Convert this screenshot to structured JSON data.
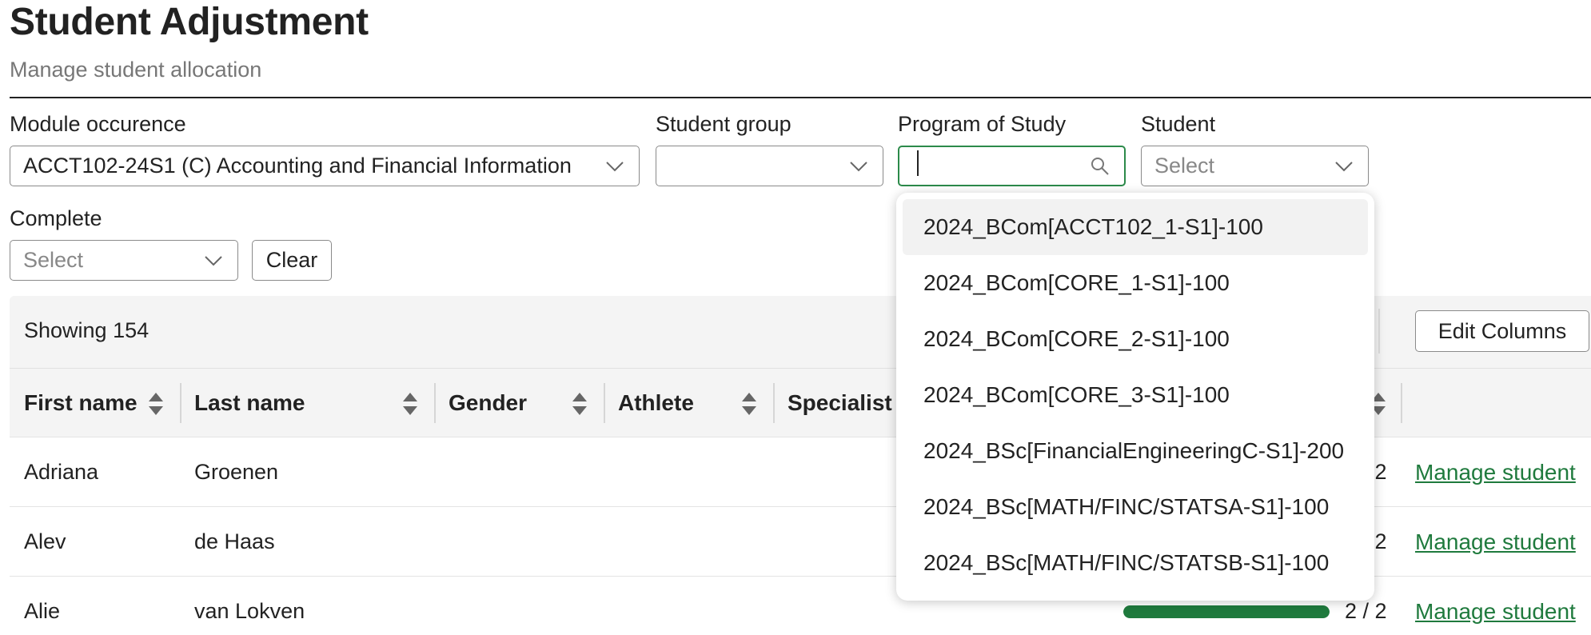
{
  "header": {
    "title": "Student Adjustment",
    "subtitle": "Manage student allocation"
  },
  "filters": {
    "module": {
      "label": "Module occurence",
      "value": "ACCT102-24S1 (C) Accounting and Financial Information"
    },
    "student_group": {
      "label": "Student group",
      "value": ""
    },
    "program": {
      "label": "Program of Study",
      "value": ""
    },
    "student": {
      "label": "Student",
      "placeholder": "Select"
    },
    "complete": {
      "label": "Complete",
      "placeholder": "Select"
    },
    "clear_label": "Clear"
  },
  "program_options": [
    "2024_BCom[ACCT102_1-S1]-100",
    "2024_BCom[CORE_1-S1]-100",
    "2024_BCom[CORE_2-S1]-100",
    "2024_BCom[CORE_3-S1]-100",
    "2024_BSc[FinancialEngineeringC-S1]-200",
    "2024_BSc[MATH/FINC/STATSA-S1]-100",
    "2024_BSc[MATH/FINC/STATSB-S1]-100"
  ],
  "table": {
    "showing": "Showing 154",
    "edit_columns_label": "Edit Columns",
    "columns": [
      "First name",
      "Last name",
      "Gender",
      "Athlete",
      "Specialist"
    ],
    "rows": [
      {
        "first": "Adriana",
        "last": "Groenen",
        "progress_text": "2 / 2",
        "progress": 1.0,
        "action": "Manage student"
      },
      {
        "first": "Alev",
        "last": "de Haas",
        "progress_text": "2 / 2",
        "progress": 1.0,
        "action": "Manage student"
      },
      {
        "first": "Alie",
        "last": "van Lokven",
        "progress_text": "2 / 2",
        "progress": 1.0,
        "action": "Manage student"
      }
    ]
  },
  "colors": {
    "accent": "#1f7a3d",
    "focus_border": "#2c8a4a"
  }
}
